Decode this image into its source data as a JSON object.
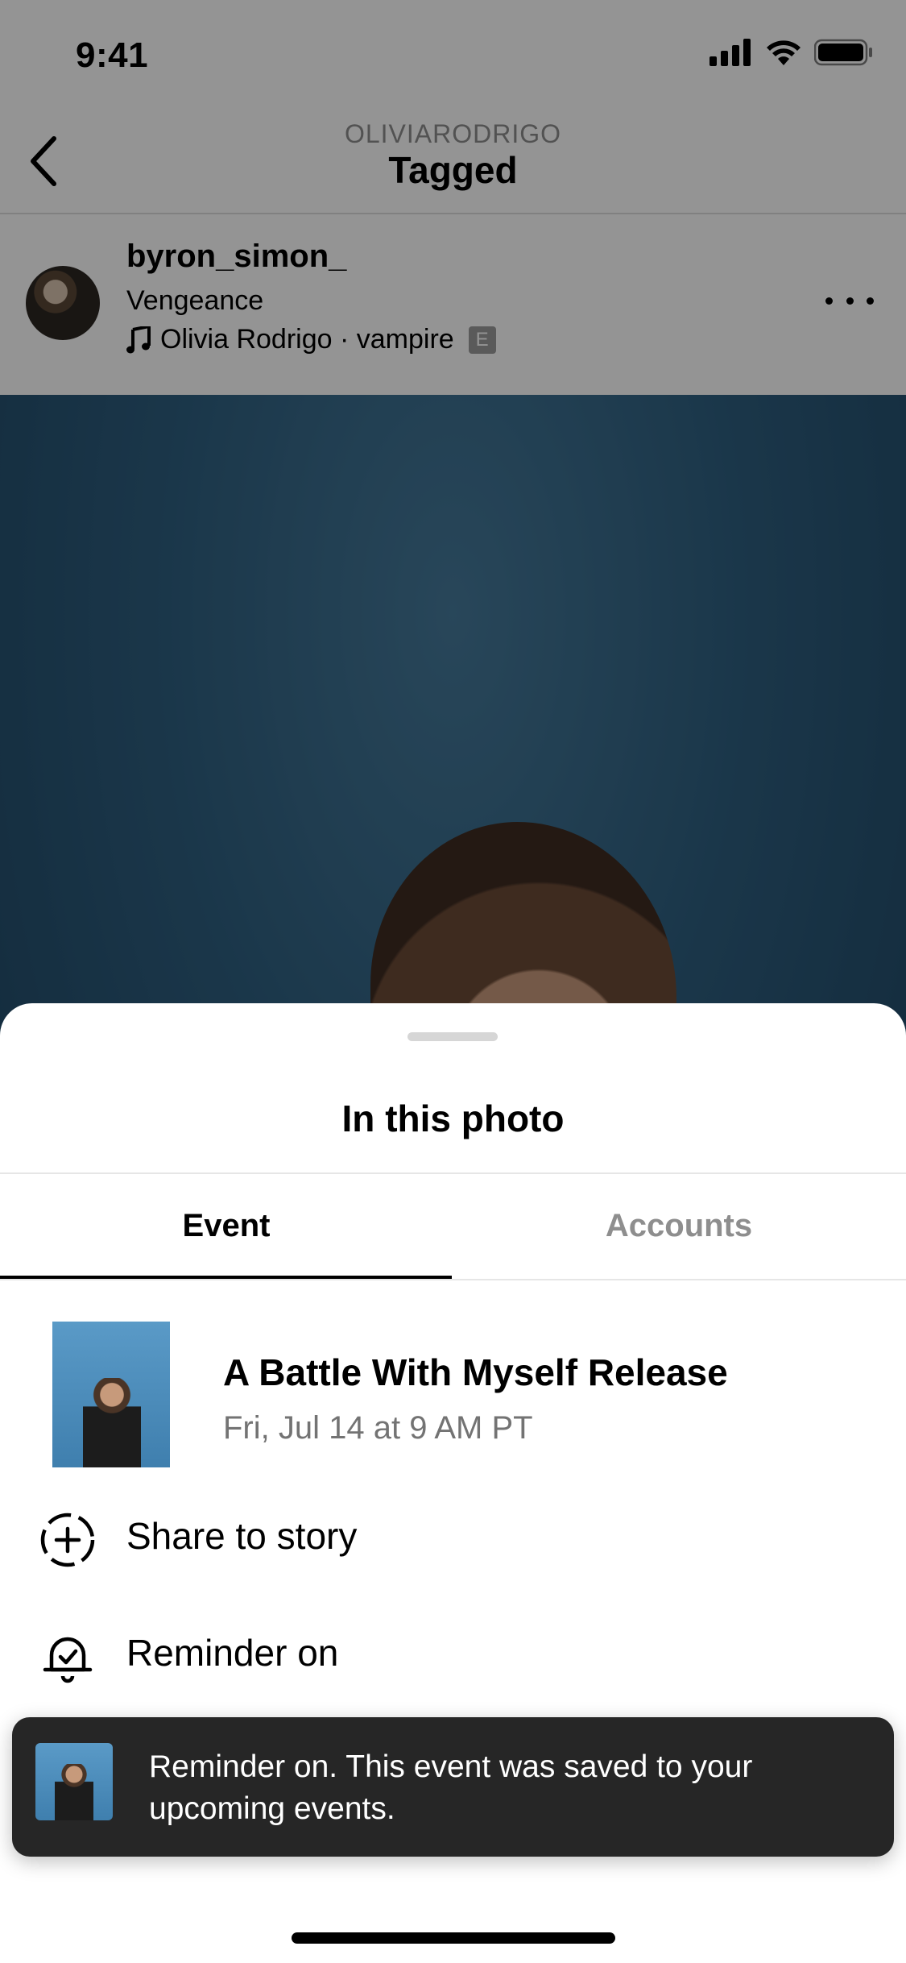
{
  "status_bar": {
    "time": "9:41"
  },
  "nav": {
    "account": "OLIVIARODRIGO",
    "title": "Tagged"
  },
  "post": {
    "username": "byron_simon_",
    "subline": "Vengeance",
    "music": "Olivia Rodrigo · vampire",
    "explicit_badge": "E"
  },
  "sheet": {
    "title": "In this photo",
    "tabs": [
      {
        "label": "Event",
        "selected": true
      },
      {
        "label": "Accounts",
        "selected": false
      }
    ],
    "event": {
      "title": "A Battle With Myself Release",
      "date": "Fri, Jul 14 at 9 AM PT"
    },
    "actions": [
      {
        "label": "Share to story",
        "icon": "add-circle-dashed-icon"
      },
      {
        "label": "Reminder on",
        "icon": "bell-check-icon"
      }
    ]
  },
  "toast": {
    "message": "Reminder on. This event was saved to your upcoming events."
  },
  "colors": {
    "toast_bg": "#262626",
    "muted_text": "#8e8e8e",
    "photo_sky": "#2e5f80"
  }
}
